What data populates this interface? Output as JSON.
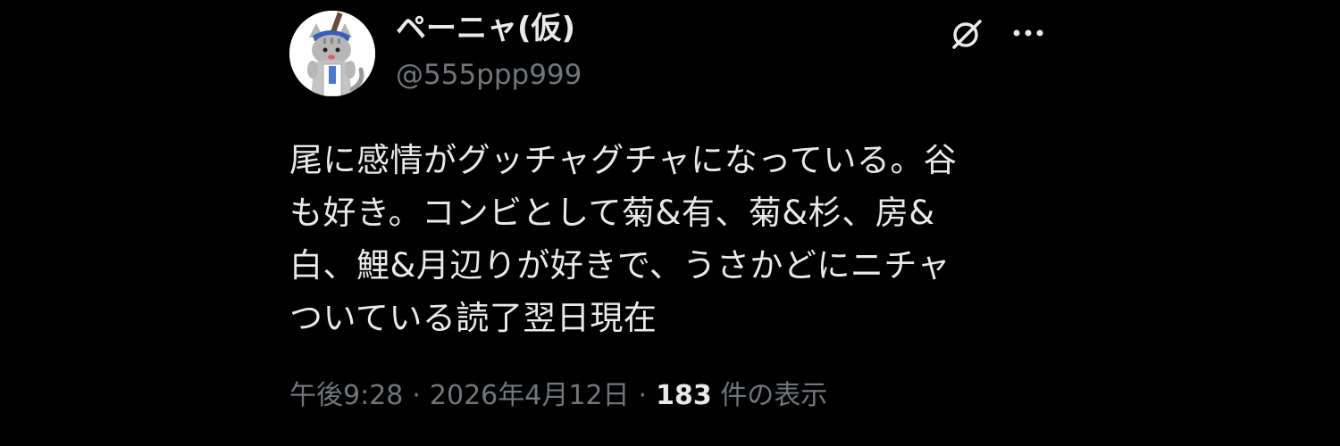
{
  "author": {
    "display_name": "ペーニャ(仮)",
    "handle": "@555ppp999"
  },
  "icons": {
    "avatar": "cat-character-avatar",
    "grok": "grok-icon",
    "more": "more-options-icon"
  },
  "post": {
    "text": "尾に感情がグッチャグチャになっている。谷\nも好き。コンビとして菊&有、菊&杉、房&\n白、鯉&月辺りが好きで、うさかどにニチャ\nついている読了翌日現在"
  },
  "meta": {
    "time": "午後9:28",
    "date": "2026年4月12日",
    "separator": "·",
    "views_count": "183",
    "views_label": "件の表示"
  },
  "colors": {
    "background": "#000000",
    "primary_text": "#e7e9ea",
    "secondary_text": "#71767b"
  }
}
